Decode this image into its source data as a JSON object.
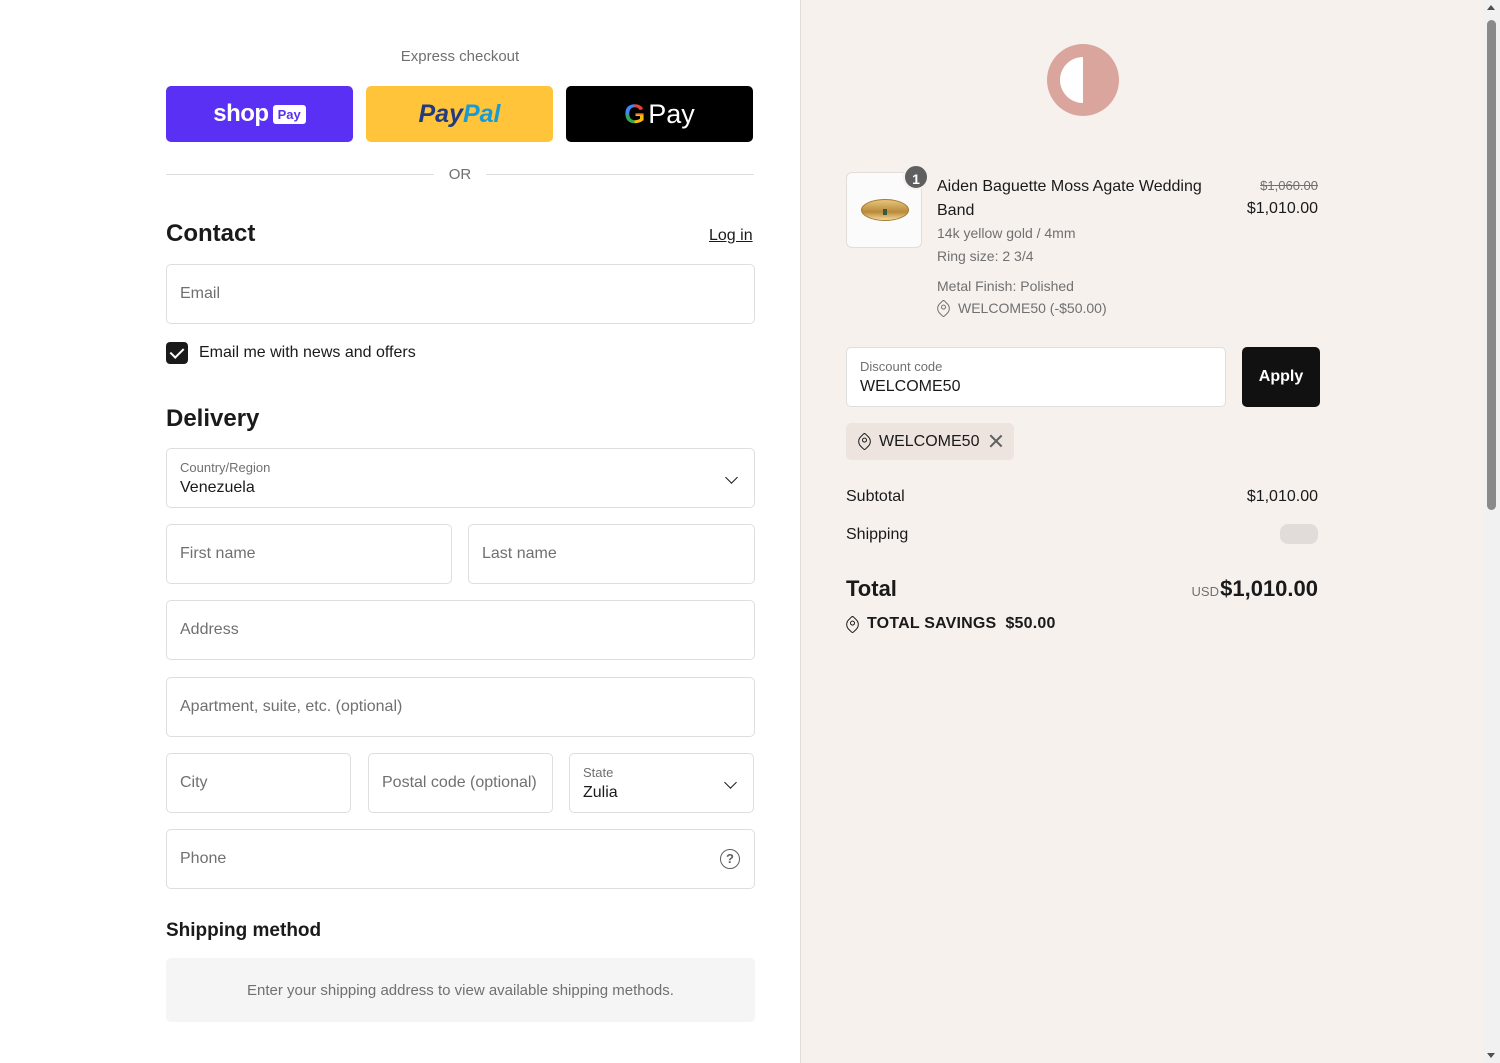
{
  "express": {
    "title": "Express checkout",
    "shop_word": "shop",
    "shop_pay": "Pay",
    "paypal_pay": "Pay",
    "paypal_pal": "Pal",
    "gpay_g": "G",
    "gpay_word": "Pay",
    "or": "OR"
  },
  "contact": {
    "heading": "Contact",
    "login": "Log in",
    "email_placeholder": "Email",
    "newsletter_label": "Email me with news and offers",
    "newsletter_checked": true
  },
  "delivery": {
    "heading": "Delivery",
    "country_label": "Country/Region",
    "country_value": "Venezuela",
    "first_name_placeholder": "First name",
    "last_name_placeholder": "Last name",
    "address_placeholder": "Address",
    "apartment_placeholder": "Apartment, suite, etc. (optional)",
    "city_placeholder": "City",
    "postal_placeholder": "Postal code (optional)",
    "state_label": "State",
    "state_value": "Zulia",
    "phone_placeholder": "Phone",
    "help_glyph": "?"
  },
  "shipping_method": {
    "heading": "Shipping method",
    "notice": "Enter your shipping address to view available shipping methods."
  },
  "order": {
    "product": {
      "name": "Aiden Baguette Moss Agate Wedding Band",
      "quantity": "1",
      "variant": "14k yellow gold / 4mm",
      "ring_size": "Ring size: 2 3/4",
      "metal_finish": "Metal Finish: Polished",
      "line_discount": "WELCOME50 (-$50.00)",
      "old_price": "$1,060.00",
      "price": "$1,010.00"
    },
    "discount": {
      "label": "Discount code",
      "value": "WELCOME50",
      "apply": "Apply",
      "applied_code": "WELCOME50"
    },
    "subtotal_label": "Subtotal",
    "subtotal_value": "$1,010.00",
    "shipping_label": "Shipping",
    "total_label": "Total",
    "total_currency": "USD",
    "total_value": "$1,010.00",
    "savings_label": "TOTAL SAVINGS",
    "savings_value": "$50.00"
  },
  "colors": {
    "shop_pay": "#5a31f4",
    "paypal": "#ffc439",
    "gpay": "#000000",
    "summary_bg": "#f7f1ee",
    "logo": "#d9a59d"
  }
}
